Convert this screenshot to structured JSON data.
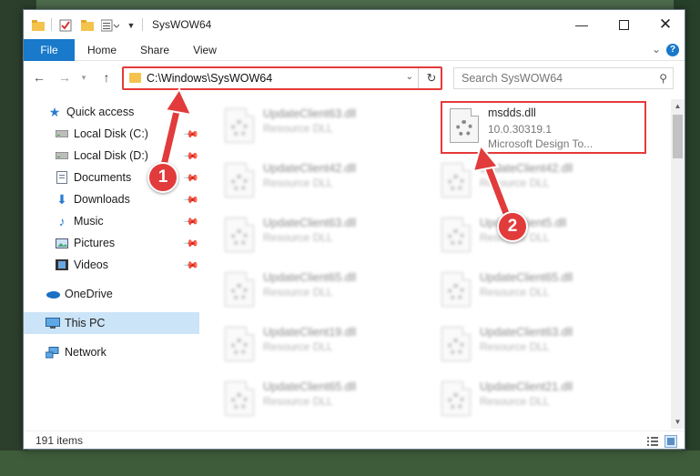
{
  "window": {
    "title": "SysWOW64",
    "ribbon_tabs": [
      {
        "label": "File"
      },
      {
        "label": "Home"
      },
      {
        "label": "Share"
      },
      {
        "label": "View"
      }
    ]
  },
  "nav": {
    "address": "C:\\Windows\\SysWOW64",
    "search_placeholder": "Search SysWOW64"
  },
  "sidebar": {
    "items": [
      {
        "label": "Quick access",
        "icon": "star-icon"
      },
      {
        "label": "Local Disk (C:)",
        "icon": "drive-icon",
        "pinned": true
      },
      {
        "label": "Local Disk (D:)",
        "icon": "drive-icon",
        "pinned": true
      },
      {
        "label": "Documents",
        "icon": "documents-icon",
        "pinned": true
      },
      {
        "label": "Downloads",
        "icon": "downloads-icon",
        "pinned": true
      },
      {
        "label": "Music",
        "icon": "music-icon",
        "pinned": true
      },
      {
        "label": "Pictures",
        "icon": "pictures-icon",
        "pinned": true
      },
      {
        "label": "Videos",
        "icon": "videos-icon",
        "pinned": true
      },
      {
        "label": "OneDrive",
        "icon": "cloud-icon"
      },
      {
        "label": "This PC",
        "icon": "computer-icon",
        "selected": true
      },
      {
        "label": "Network",
        "icon": "network-icon"
      }
    ]
  },
  "files": {
    "highlighted": {
      "name": "msdds.dll",
      "version": "10.0.30319.1",
      "description": "Microsoft Design To..."
    },
    "left_column": [
      {
        "name": "UpdateClient63.dll",
        "type": "Resource DLL"
      },
      {
        "name": "UpdateClient42.dll",
        "type": "Resource DLL"
      },
      {
        "name": "UpdateClient63.dll",
        "type": "Resource DLL"
      },
      {
        "name": "UpdateClient65.dll",
        "type": "Resource DLL"
      },
      {
        "name": "UpdateClient19.dll",
        "type": "Resource DLL"
      },
      {
        "name": "UpdateClient65.dll",
        "type": "Resource DLL"
      }
    ],
    "right_column": [
      {
        "name": "UpdateClient42.dll",
        "type": "Resource DLL"
      },
      {
        "name": "UpdateClient5.dll",
        "type": "Resource DLL"
      },
      {
        "name": "UpdateClient65.dll",
        "type": "Resource DLL"
      },
      {
        "name": "UpdateClient63.dll",
        "type": "Resource DLL"
      },
      {
        "name": "UpdateClient21.dll",
        "type": "Resource DLL"
      }
    ]
  },
  "status": {
    "items_count": "191 items"
  },
  "annotations": {
    "step1": "1",
    "step2": "2",
    "color": "#e23b3b"
  }
}
